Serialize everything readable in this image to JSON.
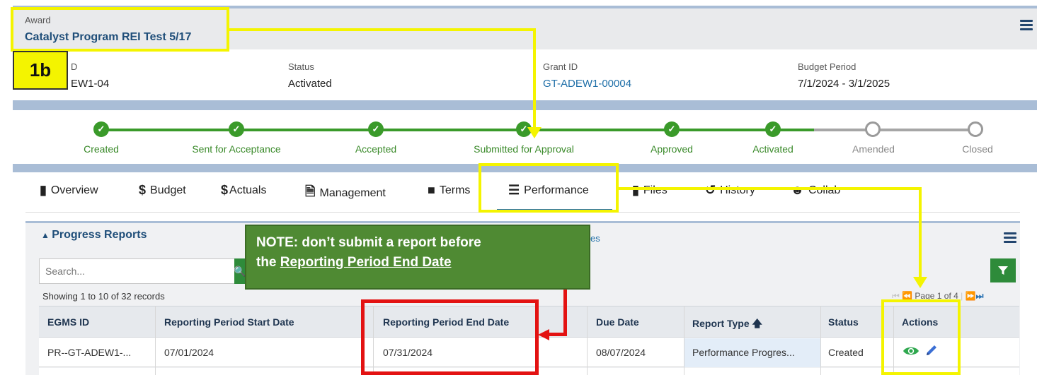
{
  "award": {
    "caption": "Award",
    "title": "Catalyst Program REI Test 5/17"
  },
  "info": {
    "id_caption": "D",
    "id_value": "EW1-04",
    "status_caption": "Status",
    "status_value": "Activated",
    "grant_caption": "Grant ID",
    "grant_value": "GT-ADEW1-00004",
    "budget_caption": "Budget Period",
    "budget_value": "7/1/2024 - 3/1/2025"
  },
  "steps": [
    {
      "label": "Created",
      "state": "done"
    },
    {
      "label": "Sent for Acceptance",
      "state": "done"
    },
    {
      "label": "Accepted",
      "state": "done"
    },
    {
      "label": "Submitted for Approval",
      "state": "done"
    },
    {
      "label": "Approved",
      "state": "done"
    },
    {
      "label": "Activated",
      "state": "done"
    },
    {
      "label": "Amended",
      "state": "todo"
    },
    {
      "label": "Closed",
      "state": "todo"
    }
  ],
  "tabs": {
    "overview": "Overview",
    "budget": "Budget",
    "actuals": "Actuals",
    "management": "Management",
    "terms": "Terms",
    "performance": "Performance",
    "files": "Files",
    "history": "History",
    "collab": "Collab"
  },
  "panel": {
    "title": "Progress Reports",
    "partial_text": "es",
    "search_placeholder": "Search...",
    "showing": "Showing 1 to 10 of 32 records",
    "page_text": "Page 1 of 4"
  },
  "table": {
    "headers": {
      "egms_id": "EGMS ID",
      "start": "Reporting Period Start Date",
      "end": "Reporting Period End Date",
      "due": "Due Date",
      "type": "Report Type",
      "status": "Status",
      "actions": "Actions"
    },
    "rows": [
      {
        "egms_id": "PR--GT-ADEW1-...",
        "start": "07/01/2024",
        "end": "07/31/2024",
        "due": "08/07/2024",
        "type": "Performance Progres...",
        "status": "Created"
      }
    ]
  },
  "annotations": {
    "tag": "1b",
    "note_line1": "NOTE: don’t submit a report before",
    "note_line2_prefix": "the ",
    "note_line2_underlined": "Reporting Period End Date"
  },
  "colors": {
    "accent_green": "#3a9a2a",
    "link_blue": "#1f6fa8",
    "highlight_yellow": "#f4f400",
    "highlight_red": "#e31212",
    "note_green": "#4f8a33"
  }
}
